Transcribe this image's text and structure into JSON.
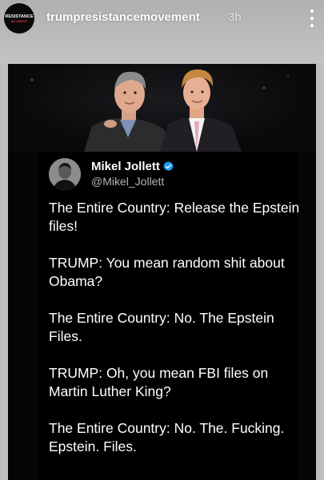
{
  "header": {
    "avatar_text": "RESISTANCE",
    "avatar_subtext": "MOVEMENT",
    "username": "trumpresistancemovement",
    "time": "3h",
    "more_icon": "more-vertical-icon"
  },
  "tweet": {
    "name": "Mikel Jollett",
    "handle": "@Mikel_Jollett",
    "verified_icon": "verified-badge-icon",
    "verified_color": "#1d9bf0",
    "paragraphs": [
      "The Entire Country: Release the Epstein files!",
      "TRUMP: You mean random shit about Obama?",
      "The Entire Country: No. The Epstein Files.",
      "TRUMP: Oh, you mean FBI files on Martin Luther King?",
      "The Entire Country: No. The. Fucking. Epstein. Files."
    ]
  },
  "colors": {
    "background": "#000000",
    "story_band": "#bdbdbd",
    "text": "#ffffff",
    "handle": "#b3b3b3"
  }
}
